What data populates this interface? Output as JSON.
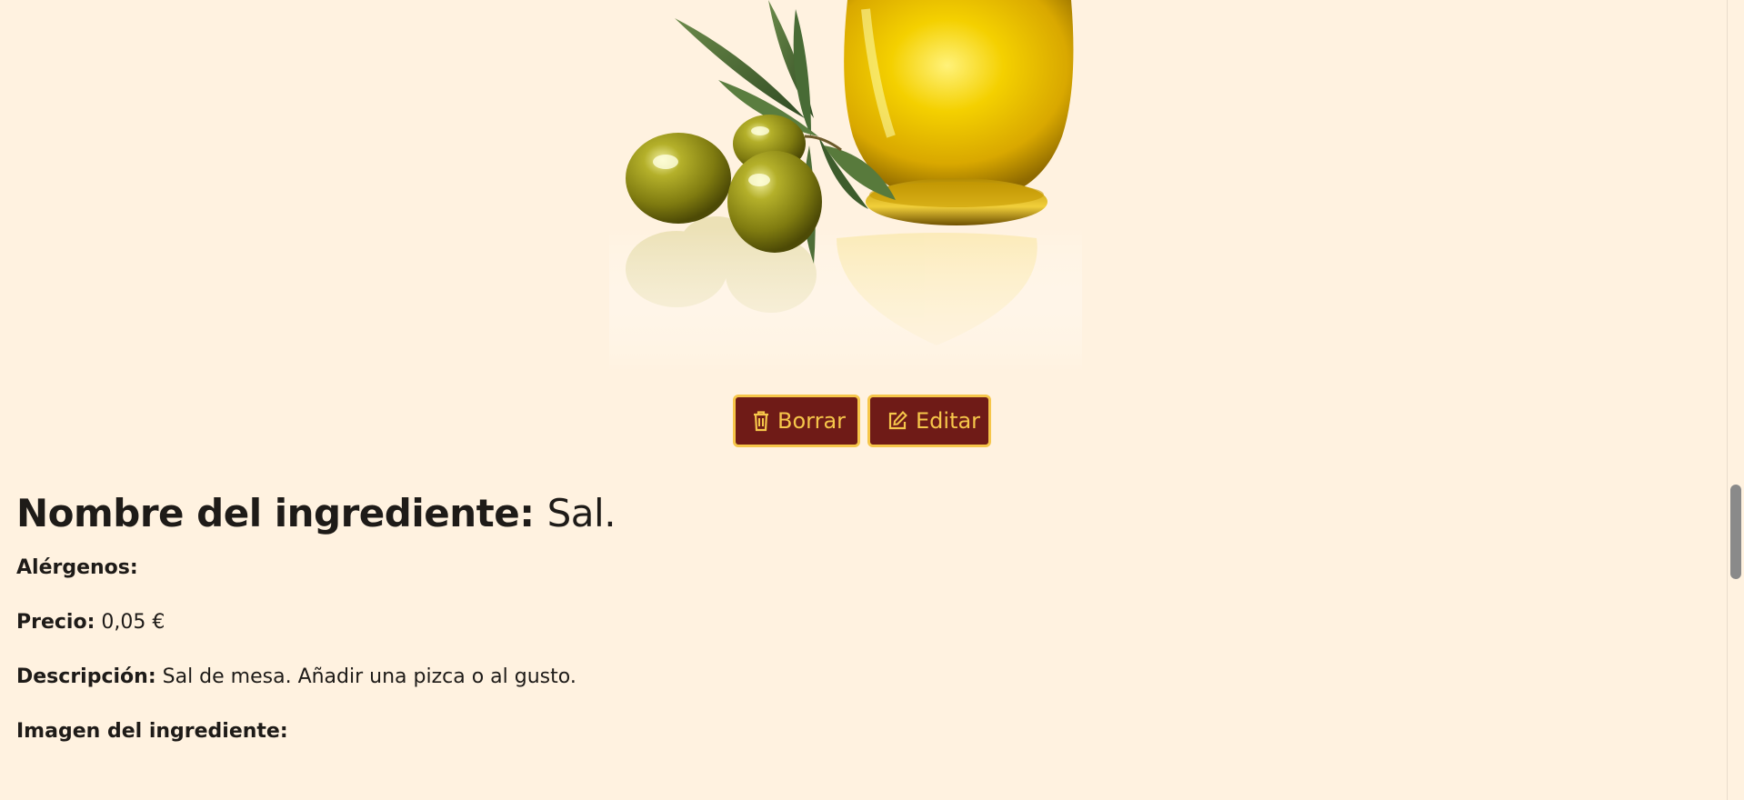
{
  "actions": {
    "delete_label": "Borrar",
    "edit_label": "Editar"
  },
  "ingredient": {
    "name_label": "Nombre del ingrediente:",
    "name_value": "Sal.",
    "allergens_label": "Alérgenos:",
    "allergens_value": "",
    "price_label": "Precio:",
    "price_value": "0,05 €",
    "description_label": "Descripción:",
    "description_value": "Sal de mesa. Añadir una pizca o al gusto.",
    "image_label": "Imagen del ingrediente:"
  },
  "colors": {
    "background": "#fff2e0",
    "button_bg": "#6f1b17",
    "button_accent": "#f6c64a",
    "text": "#1e1b18"
  },
  "icons": {
    "delete": "trash-icon",
    "edit": "edit-icon"
  }
}
